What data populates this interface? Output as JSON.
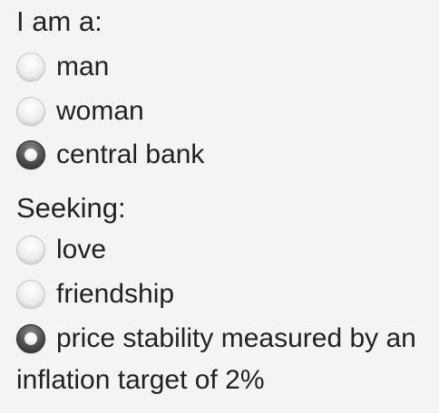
{
  "section_i_am": {
    "heading": "I am a:",
    "options": [
      {
        "label": "man",
        "checked": false
      },
      {
        "label": "woman",
        "checked": false
      },
      {
        "label": "central bank",
        "checked": true
      }
    ]
  },
  "section_seeking": {
    "heading": "Seeking:",
    "options": [
      {
        "label": "love",
        "checked": false
      },
      {
        "label": "friendship",
        "checked": false
      },
      {
        "label": "price stability measured by an",
        "checked": true,
        "continuation": "inflation target of 2%"
      }
    ]
  }
}
